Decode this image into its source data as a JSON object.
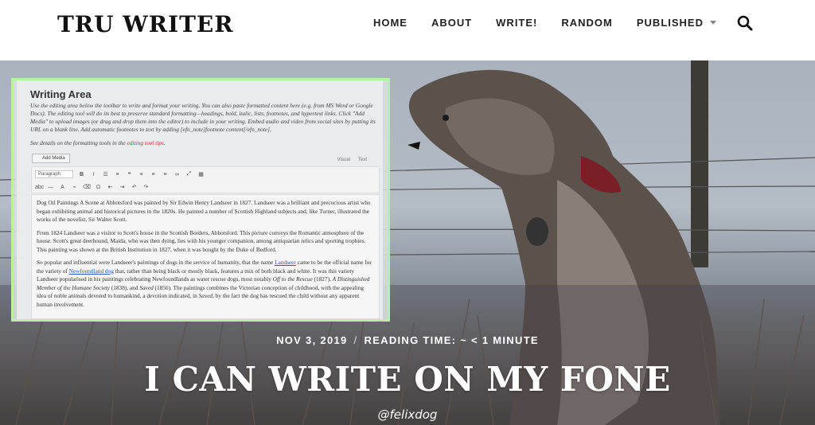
{
  "site": {
    "logo": "TRU WRITER"
  },
  "nav": {
    "items": [
      {
        "label": "HOME"
      },
      {
        "label": "ABOUT"
      },
      {
        "label": "WRITE!"
      },
      {
        "label": "RANDOM"
      },
      {
        "label": "PUBLISHED"
      }
    ],
    "search_icon": "search-icon"
  },
  "editor": {
    "title": "Writing Area",
    "description": "Use the editing area below the toolbar to write and format your writing. You can also paste formatted content here (e.g. from MS Word or Google Docs). The editing tool will do its best to preserve standard formatting—headings, bold, italic, lists, footnotes, and hypertext links. Click \"Add Media\" to upload images (or drag and drop them into the editor) to include in your writing. Embed audio and video from social sites by putting its URL on a blank line. Add automatic footnotes to text by adding [efn_note]footnote content[/efn_note].",
    "tips_prefix": "See details on the formatting tools in the ",
    "tips_link": "editing tool tips",
    "tips_suffix": ".",
    "add_media": "Add Media",
    "tab_visual": "Visual",
    "tab_text": "Text",
    "paragraph_select": "Paragraph",
    "body": {
      "p1": "Dog Oil Paintings A Scene at Abbotsford was painted by Sir Edwin Henry Landseer in 1827. Landseer was a brilliant and precocious artist who began exhibiting animal and historical pictures in the 1820s. He painted a number of Scottish Highland subjects and, like Turner, illustrated the works of the novelist, Sir Walter Scott.",
      "p2": "From 1824 Landseer was a visitor to Scott's house in the Scottish Borders, Abbotsford. This picture conveys the Romantic atmosphere of the house. Scott's great deerhound, Maida, who was then dying, lies with his younger companion, among antiquarian relics and sporting trophies. This painting was shown at the British Institution in 1827, when it was bought by the Duke of Bedford.",
      "p3_a": "So popular and influential were Landseer's paintings of dogs in the service of humanity, that the name ",
      "p3_link1": "Landseer",
      "p3_b": " came to be the official name for the variety of ",
      "p3_link2": "Newfoundland dog",
      "p3_c": " that, rather than being black or mostly black, features a mix of both black and white. It was this variety Landseer popularised in his paintings celebrating Newfoundlands as water rescue dogs, most notably ",
      "p3_i1": "Off to the Rescue",
      "p3_d": " (1827), ",
      "p3_i2": "A Distinguished Member of the Humane Society",
      "p3_e": " (1838), and ",
      "p3_i3": "Saved",
      "p3_f": " (1856). The paintings combines the Victorian conception of childhood, with the appealing idea of noble animals devoted to humankind, a devotion indicated, in ",
      "p3_i4": "Saved",
      "p3_g": ", by the fact the dog has rescued the child without any apparent human involvement."
    }
  },
  "post": {
    "date": "NOV 3, 2019",
    "separator": "/",
    "reading_time": "READING TIME: ~ < 1 MINUTE",
    "title": "I CAN WRITE ON MY FONE",
    "author": "@felixdog"
  },
  "colors": {
    "accent_green": "#b9f0a6",
    "link_red": "#c0392b",
    "link_blue": "#2a5ab8"
  }
}
